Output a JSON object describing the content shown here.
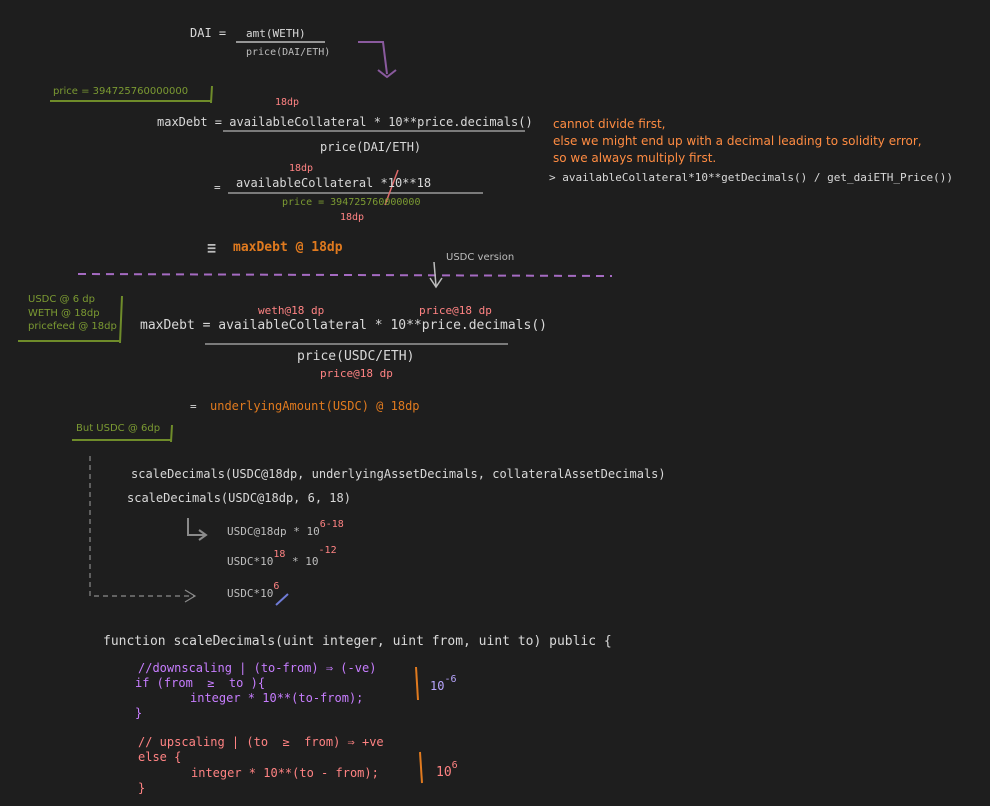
{
  "top": {
    "dai_label": "DAI =",
    "numerator": "amt(WETH)",
    "denominator": "price(DAI/ETH)"
  },
  "section1": {
    "price_note": "price = 394725760000000",
    "dp18_a": "18dp",
    "formula": "maxDebt = availableCollateral * 10**price.decimals()",
    "formula_den": "price(DAI/ETH)",
    "dp18_b": "18dp",
    "eq": "=",
    "num2": "availableCollateral *10**18",
    "den2": "price = 394725760000000",
    "dp18_c": "18dp",
    "result_eq": "≡",
    "result": "maxDebt @ 18dp"
  },
  "side_note": {
    "line1": "cannot divide first,",
    "line2": "else we might end up with a decimal leading to solidity error,",
    "line3": "so we always multiply first.",
    "code": "> availableCollateral*10**getDecimals() / get_daiETH_Price())"
  },
  "divider_label": "USDC version",
  "section2": {
    "side_notes": [
      "USDC @ 6 dp",
      "WETH @ 18dp",
      "pricefeed @ 18dp"
    ],
    "weth_label": "weth@18 dp",
    "price_label": "price@18 dp",
    "formula": "maxDebt = availableCollateral * 10**price.decimals()",
    "den": "price(USDC/ETH)",
    "den_label": "price@18 dp",
    "eq": "=",
    "result": "underlyingAmount(USDC) @ 18dp",
    "but_note": "But USDC @ 6dp"
  },
  "scale": {
    "line1": "scaleDecimals(USDC@18dp, underlyingAssetDecimals, collateralAssetDecimals)",
    "line2": "scaleDecimals(USDC@18dp, 6, 18)",
    "step1_base": "USDC@18dp * 10",
    "step1_exp": "6-18",
    "step2_a": "USDC*10",
    "step2_exp1": "18",
    "step2_b": " * 10",
    "step2_exp2": "-12",
    "step3_base": "USDC*10",
    "step3_exp": "6"
  },
  "code": {
    "sig": "function scaleDecimals(uint integer, uint from, uint to) public {",
    "c1": "//downscaling | (to-from) ⇒ (-ve)",
    "c2": "if (from  ≥  to ){",
    "c3": "integer * 10**(to-from);",
    "c4": "}",
    "note1_base": "10",
    "note1_exp": "-6",
    "c5": "// upscaling | (to  ≥  from) ⇒ +ve",
    "c6": "else {",
    "c7": "integer * 10**(to - from);",
    "c8": "}",
    "note2_base": "10",
    "note2_exp": "6"
  }
}
